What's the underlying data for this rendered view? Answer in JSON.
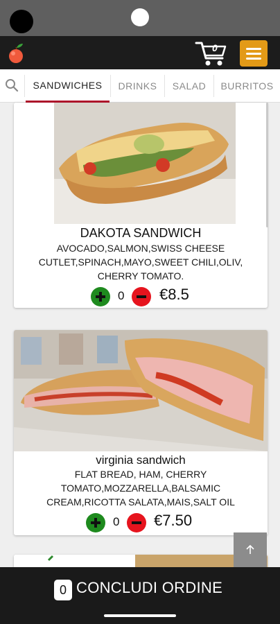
{
  "header": {
    "cart_count": "0",
    "logo_icon": "apple-logo-icon",
    "cart_icon": "cart-icon",
    "menu_icon": "hamburger-menu-icon"
  },
  "tabs": {
    "search_icon": "search-icon",
    "items": [
      {
        "label": "SANDWICHES",
        "active": true
      },
      {
        "label": "DRINKS",
        "active": false
      },
      {
        "label": "SALAD",
        "active": false
      },
      {
        "label": "BURRITOS",
        "active": false
      }
    ]
  },
  "products": [
    {
      "title": "DAKOTA SANDWICH",
      "description_lines": [
        "AVOCADO,SALMON,SWISS CHEESE",
        "CUTLET,SPINACH,MAYO,SWEET CHILI,OLIV,",
        "CHERRY TOMATO."
      ],
      "quantity": "0",
      "price": "€8.5"
    },
    {
      "title": "virginia sandwich",
      "description_lines": [
        "FLAT BREAD, HAM, CHERRY",
        "TOMATO,MOZZARELLA,BALSAMIC",
        "CREAM,RICOTTA SALATA,MAIS,SALT OIL"
      ],
      "quantity": "0",
      "price": "€7.50"
    }
  ],
  "order": {
    "count": "0",
    "label": "CONCLUDI ORDINE"
  },
  "colors": {
    "accent": "#e39a17",
    "active_tab_underline": "#b0102a",
    "plus_button": "#1e8a1e",
    "minus_button": "#e6141e"
  }
}
